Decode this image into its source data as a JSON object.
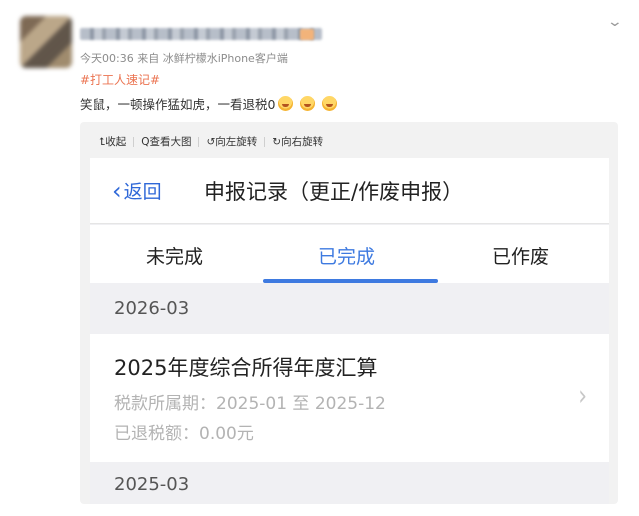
{
  "post": {
    "meta": "今天00:36  来自 冰鲜柠檬水iPhone客户端",
    "hashtag": "#打工人速记#",
    "text": "笑鼠，一顿操作猛如虎，一看退税0",
    "emoji_count": 3
  },
  "toolbar": {
    "collapse": "⮤收起",
    "view_large": "Q查看大图",
    "rotate_left": "↺向左旋转",
    "rotate_right": "↻向右旋转"
  },
  "screen": {
    "back_label": "返回",
    "title": "申报记录（更正/作废申报）",
    "tabs": [
      "未完成",
      "已完成",
      "已作废"
    ],
    "active_tab": 1,
    "groups": [
      {
        "month": "2026-03",
        "records": [
          {
            "title": "2025年度综合所得年度汇算",
            "period": "税款所属期：2025-01 至 2025-12",
            "refund": "已退税额：0.00元"
          }
        ]
      },
      {
        "month": "2025-03"
      }
    ]
  },
  "colors": {
    "accent_blue": "#3e7ae0",
    "hashtag_orange": "#eb7350"
  }
}
